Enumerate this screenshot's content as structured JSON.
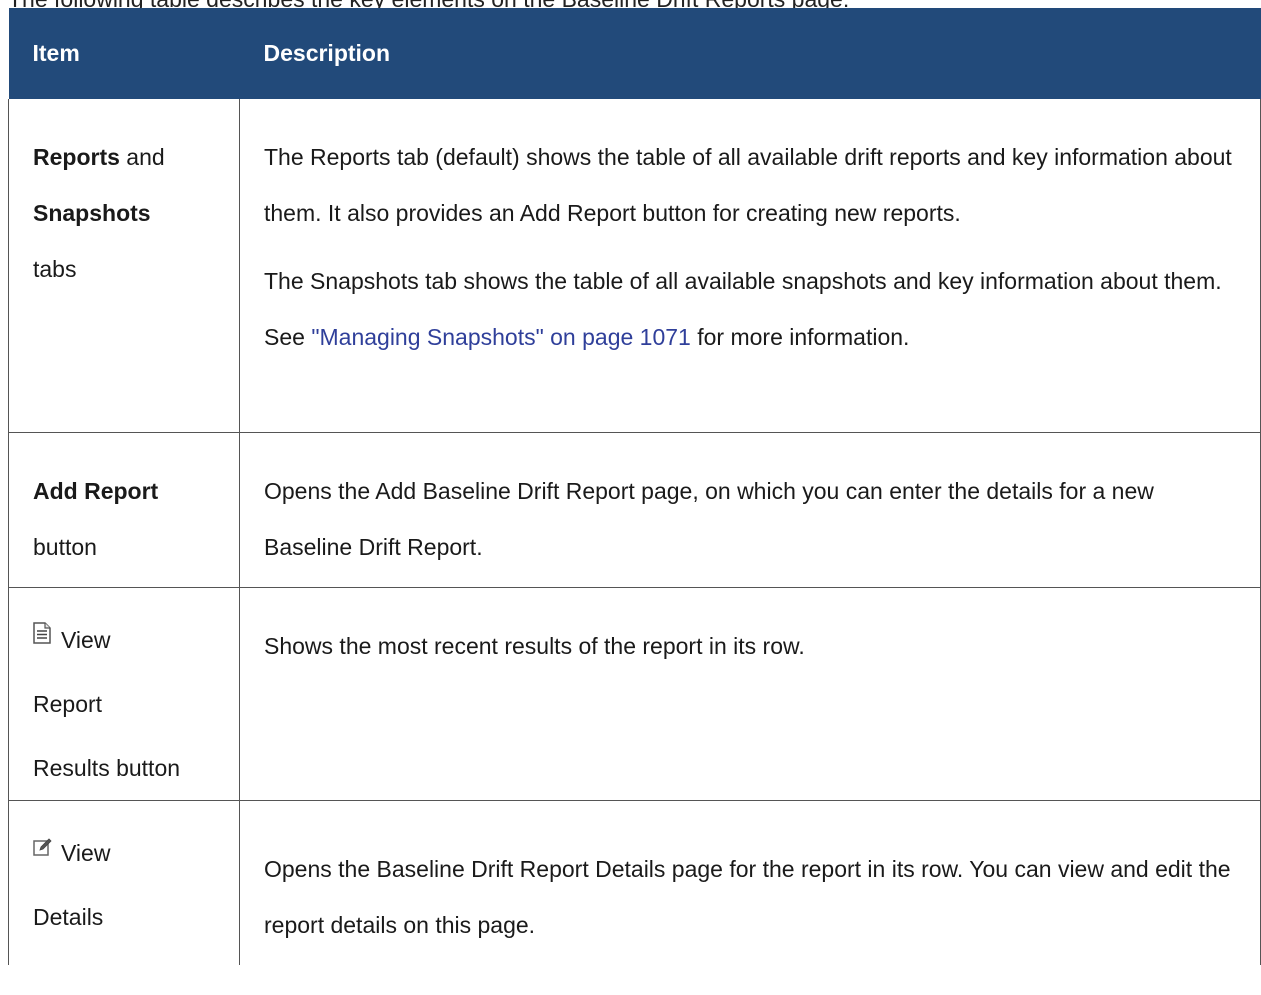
{
  "cutoff_text": "The following table describes the key elements on the Baseline Drift Reports page:",
  "table": {
    "headers": [
      "Item",
      "Description"
    ],
    "rows": [
      {
        "item_bold_1": "Reports",
        "item_text_1": " and ",
        "item_bold_2": "Snapshots",
        "item_text_2": "tabs",
        "desc_p1": "The Reports tab (default) shows the table of all available drift reports and key information about them. It also provides an Add Report button for creating new reports.",
        "desc_p2_before": "The Snapshots tab shows the table of all available snapshots and key information about them. See ",
        "desc_p2_link": "\"Managing Snapshots\" on page 1071",
        "desc_p2_after": " for more information."
      },
      {
        "item_bold_1": "Add Report",
        "item_text_2": "button",
        "desc_p1": "Opens the Add Baseline Drift Report page, on which you can enter the details for a new Baseline Drift Report."
      },
      {
        "icon": "document-lines-icon",
        "item_text_1": "View",
        "item_text_2": "Report",
        "item_text_3": "Results button",
        "desc_p1": "Shows the most recent results of the report in its row."
      },
      {
        "icon": "edit-pencil-icon",
        "item_text_1": "View",
        "item_text_2": "Details",
        "desc_p1": "Opens the Baseline Drift Report Details page for the report in its row. You can view and edit the report details on this page."
      }
    ]
  },
  "colors": {
    "header_bg": "#224a7a",
    "header_text": "#ffffff",
    "link": "#2f3f9a"
  }
}
